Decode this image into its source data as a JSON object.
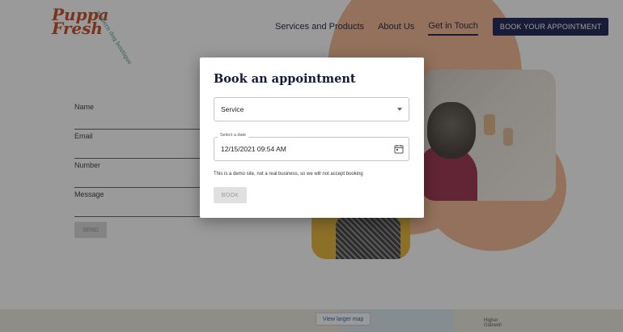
{
  "brand": {
    "logo_line1": "Puppa",
    "logo_line2": "Fresh",
    "logo_tagline": "modern dog boutique"
  },
  "nav": {
    "items": [
      {
        "label": "Services and Products"
      },
      {
        "label": "About Us"
      },
      {
        "label": "Get in Touch",
        "active": true
      }
    ],
    "cta_label": "BOOK YOUR APPOINTMENT"
  },
  "contact_form": {
    "fields": [
      {
        "label": "Name"
      },
      {
        "label": "Email"
      },
      {
        "label": "Number"
      },
      {
        "label": "Message"
      }
    ],
    "send_label": "SEND"
  },
  "map": {
    "larger_map_label": "View larger map",
    "place_label_line1": "Higher",
    "place_label_line2": "Gabwell"
  },
  "modal": {
    "title": "Book an appointment",
    "service_select": {
      "selected": "Service"
    },
    "date_field": {
      "label": "Select a date",
      "value": "12/15/2021 09:54 AM"
    },
    "notice": "This is a demo site, not a real business, so we will not accept booking",
    "book_label": "BOOK"
  },
  "colors": {
    "accent_navy": "#141a4a",
    "brand_orange": "#c4461e",
    "peach": "#f2b58e",
    "overlay": "rgba(30,30,30,0.45)"
  }
}
